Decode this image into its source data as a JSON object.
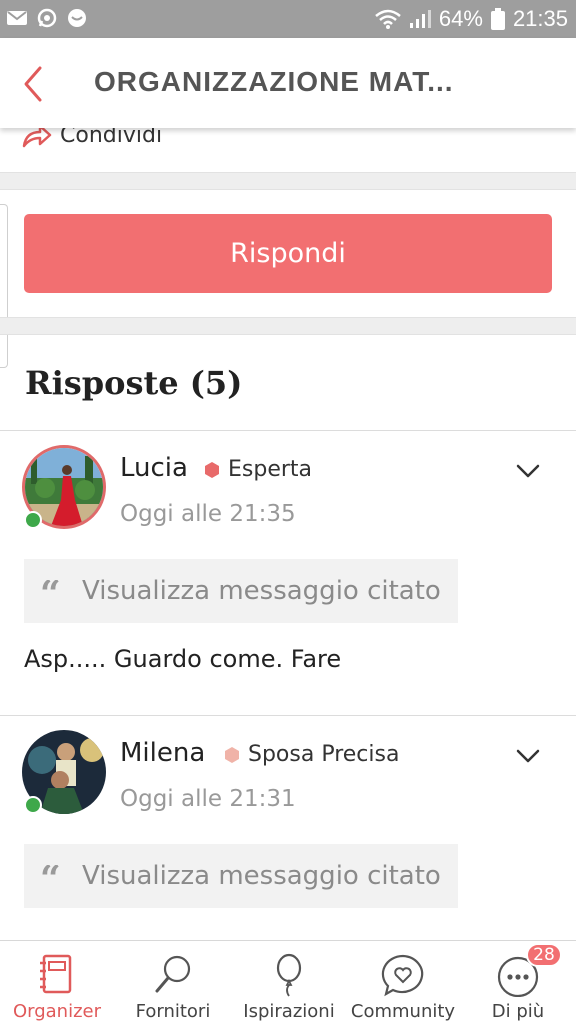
{
  "status_bar": {
    "battery": "64%",
    "time": "21:35",
    "left_icons": [
      "mail-icon",
      "whatsapp-icon",
      "chat-bubble-icon"
    ],
    "right_icons": [
      "wifi-icon",
      "signal-icon",
      "battery-icon"
    ]
  },
  "header": {
    "title": "ORGANIZZAZIONE MAT...",
    "back_icon": "chevron-left-icon"
  },
  "share": {
    "label": "Condividi"
  },
  "reply_button": {
    "label": "Rispondi"
  },
  "replies": {
    "title": "Risposte (5)",
    "posts": [
      {
        "author": "Lucia",
        "badge": "Esperta",
        "badge_color": "#e86a6a",
        "time": "Oggi alle 21:35",
        "quote_label": "Visualizza messaggio citato",
        "text": "Asp..... Guardo come. Fare",
        "online": true
      },
      {
        "author": "Milena",
        "badge": "Sposa Precisa",
        "badge_color": "#f0b3a8",
        "time": "Oggi alle 21:31",
        "quote_label": "Visualizza messaggio citato",
        "text": "",
        "online": true
      }
    ]
  },
  "bottom_nav": {
    "items": [
      {
        "label": "Organizer",
        "icon": "notebook-icon",
        "active": true
      },
      {
        "label": "Fornitori",
        "icon": "magnifier-icon",
        "active": false
      },
      {
        "label": "Ispirazioni",
        "icon": "balloon-icon",
        "active": false
      },
      {
        "label": "Community",
        "icon": "heart-chat-icon",
        "active": false
      },
      {
        "label": "Di più",
        "icon": "more-icon",
        "active": false,
        "badge": "28"
      }
    ]
  },
  "colors": {
    "accent": "#f26f71",
    "online": "#3ea84a",
    "status_bar": "#9e9e9e"
  }
}
